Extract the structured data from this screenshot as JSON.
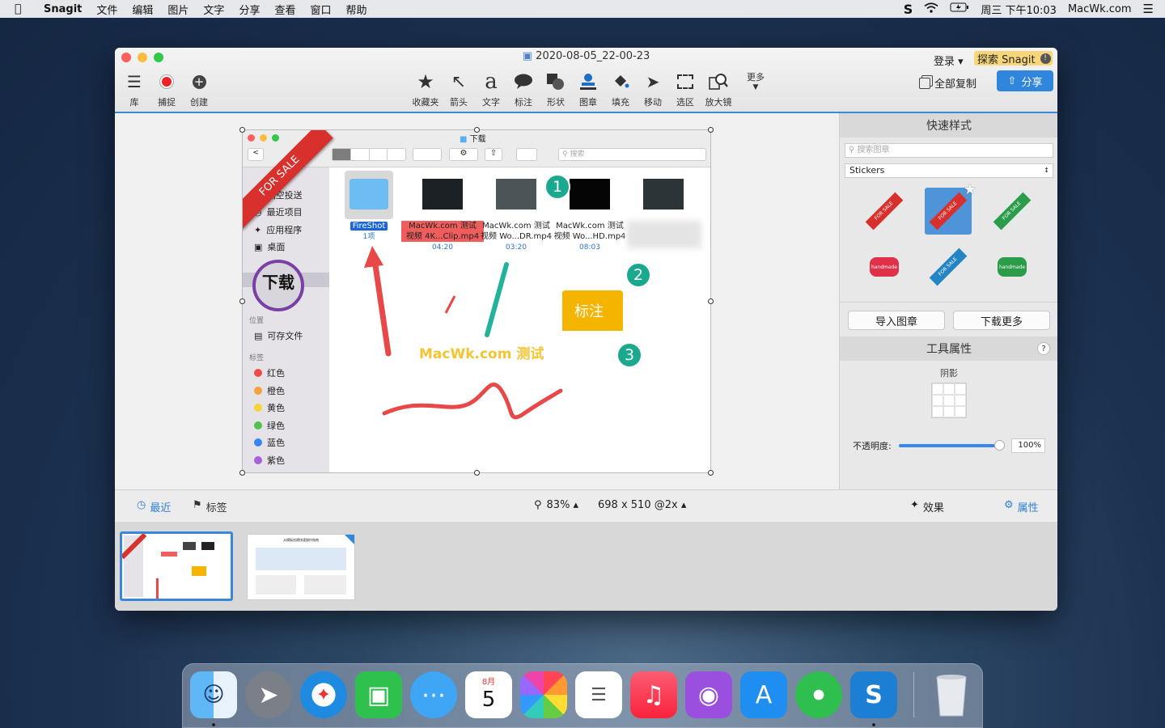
{
  "menubar": {
    "app": "Snagit",
    "items": [
      "文件",
      "编辑",
      "图片",
      "文字",
      "分享",
      "查看",
      "窗口",
      "帮助"
    ],
    "clock": "周三 下午10:03",
    "site": "MacWk.com"
  },
  "window": {
    "title": "2020-08-05_22-00-23",
    "login": "登录 ▾",
    "explore": "探索 Snagit"
  },
  "toolbar": {
    "library": "库",
    "capture": "捕捉",
    "create": "创建",
    "tools": [
      "收藏夹",
      "箭头",
      "文字",
      "标注",
      "形状",
      "图章",
      "填充",
      "移动",
      "选区",
      "放大镜"
    ],
    "more": "更多",
    "copy_all": "全部复制",
    "share": "分享"
  },
  "finder": {
    "title": "下载",
    "search_placeholder": "搜索",
    "sidebar": {
      "airdrop": "隔空投送",
      "recents": "最近项目",
      "apps": "应用程序",
      "desktop": "桌面",
      "downloads": "下载",
      "locations_header": "位置",
      "icloud": "可存文件",
      "tags_header": "标签",
      "tags": [
        {
          "name": "红色",
          "color": "#f04b4b"
        },
        {
          "name": "橙色",
          "color": "#f5a03a"
        },
        {
          "name": "黄色",
          "color": "#f5d33a"
        },
        {
          "name": "绿色",
          "color": "#4fc14f"
        },
        {
          "name": "蓝色",
          "color": "#3a86f0"
        },
        {
          "name": "紫色",
          "color": "#a85fd8"
        }
      ]
    },
    "files": [
      {
        "name": "FireShot",
        "sub": "1项"
      },
      {
        "name": "MacWk.com 测试\n视频 4K...Clip.mp4",
        "sub": "04:20"
      },
      {
        "name": "MacWk.com 测试\n视频 Wo...DR.mp4",
        "sub": "03:20"
      },
      {
        "name": "MacWk.com 测试\n视频 Wo...HD.mp4",
        "sub": "08:03"
      }
    ]
  },
  "annotations": {
    "ribbon": "FOR SALE",
    "step1": "1",
    "step2": "2",
    "step3": "3",
    "callout": "标注",
    "watermark": "MacWk.com 测试",
    "magnify": "下载"
  },
  "right_panel": {
    "quick_styles": "快速样式",
    "search_placeholder": "搜索图章",
    "category": "Stickers",
    "import": "导入图章",
    "download_more": "下载更多",
    "tool_props": "工具属性",
    "shadow": "阴影",
    "opacity_label": "不透明度:",
    "opacity_value": "100%",
    "help": "?",
    "sticker_texts": [
      "FOR SALE",
      "handmade"
    ]
  },
  "statusbar": {
    "recent": "最近",
    "tags": "标签",
    "zoom": "83% ▴",
    "size": "698 x 510 @2x ▴",
    "effects": "效果",
    "properties": "属性"
  },
  "tray": {
    "thumb2_title": "从模板创建快速操作指南"
  },
  "dock": {
    "calendar_month": "8月",
    "calendar_day": "5",
    "apps": [
      "finder",
      "launchpad",
      "safari",
      "facetime",
      "messages",
      "calendar",
      "photos",
      "reminders",
      "music",
      "podcasts",
      "app-store",
      "find-my",
      "snagit",
      "trash"
    ]
  }
}
